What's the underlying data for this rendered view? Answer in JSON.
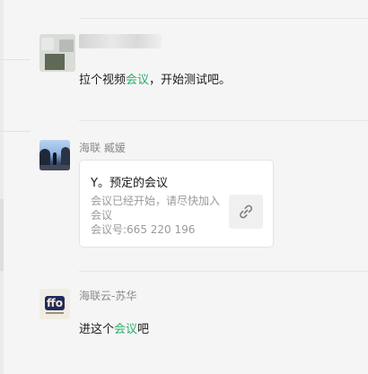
{
  "chat": {
    "messages": [
      {
        "sender": "",
        "text_before": "拉个视频",
        "link_text": "会议",
        "text_after": "，开始测试吧。"
      },
      {
        "sender": "海联 臧媛",
        "card": {
          "title": "Y。预定的会议",
          "description": "会议已经开始，请尽快加入会议",
          "meeting_id": "会议号:665 220 196",
          "icon": "link-icon"
        }
      },
      {
        "sender": "海联云-苏华",
        "text_before": "进这个",
        "link_text": "会议",
        "text_after": "吧"
      }
    ]
  },
  "colors": {
    "link": "#2aae67",
    "background": "#f5f5f5",
    "card": "#ffffff"
  }
}
